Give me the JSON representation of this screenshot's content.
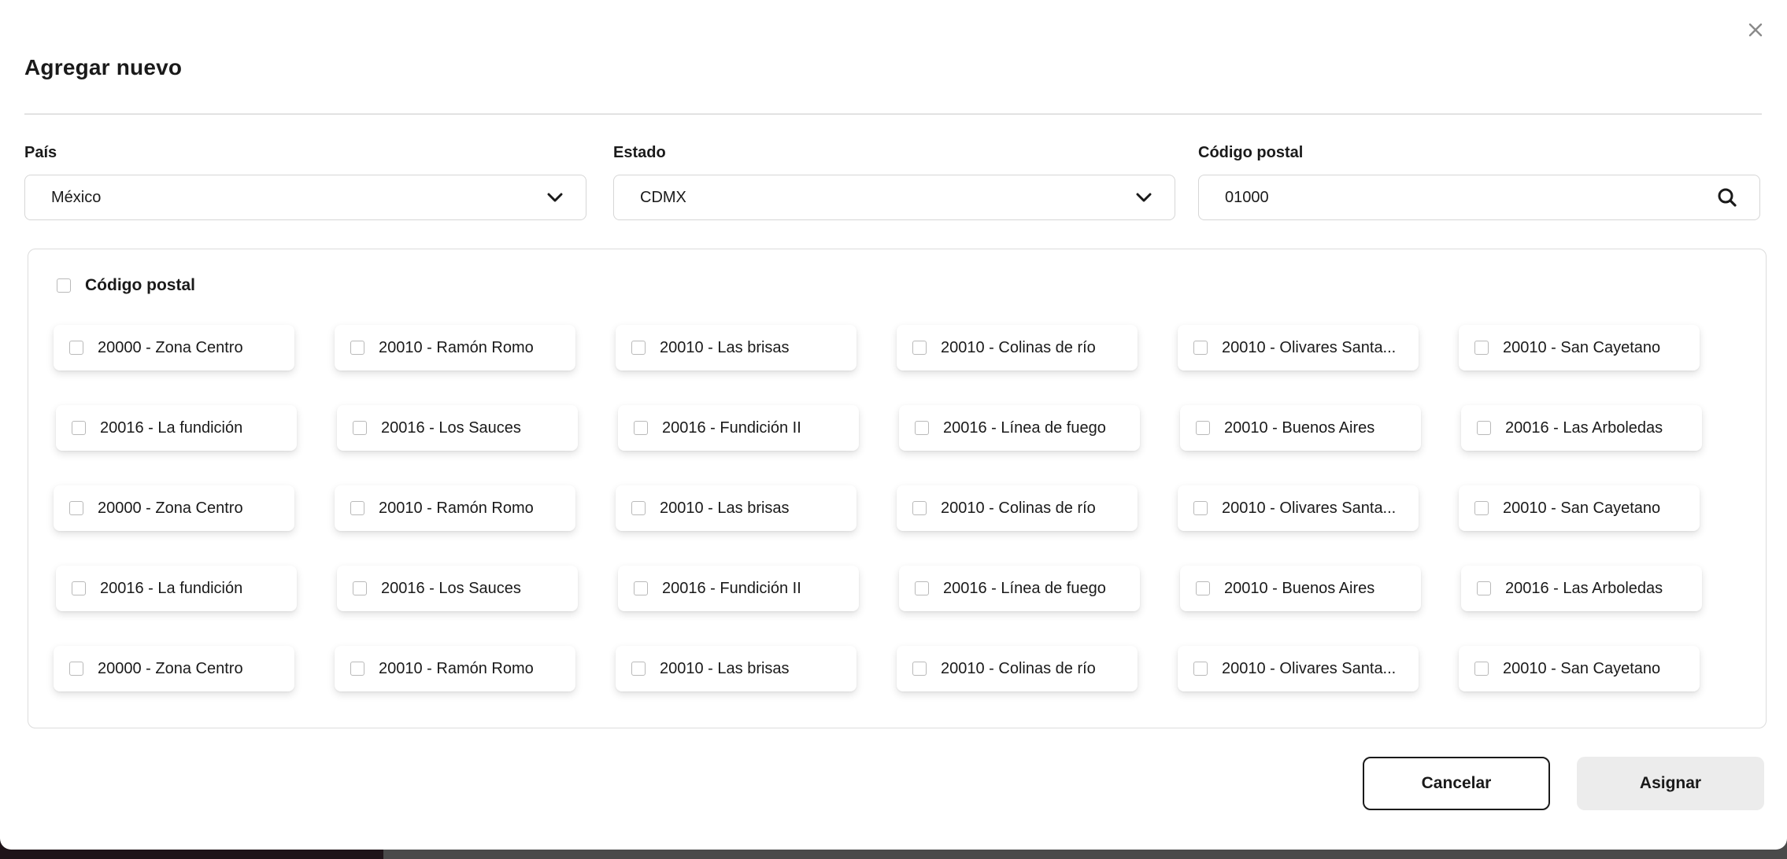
{
  "modal": {
    "title": "Agregar nuevo",
    "close_icon": "close-icon"
  },
  "filters": {
    "country": {
      "label": "País",
      "value": "México",
      "icon": "chevron-down-icon"
    },
    "state": {
      "label": "Estado",
      "value": "CDMX",
      "icon": "chevron-down-icon"
    },
    "postal_code": {
      "label": "Código postal",
      "value": "01000",
      "icon": "search-icon"
    }
  },
  "results": {
    "select_all_label": "Código postal",
    "rows": [
      [
        "20000 - Zona Centro",
        "20010 - Ramón Romo",
        "20010 - Las brisas",
        "20010 - Colinas de río",
        "20010 - Olivares Santa...",
        "20010 - San Cayetano"
      ],
      [
        "20016 - La fundición",
        "20016 - Los Sauces",
        "20016 - Fundición II",
        "20016 - Línea de fuego",
        "20010 - Buenos Aires",
        "20016 - Las Arboledas"
      ],
      [
        "20000 - Zona Centro",
        "20010 - Ramón Romo",
        "20010 - Las brisas",
        "20010 - Colinas de río",
        "20010 - Olivares Santa...",
        "20010 - San Cayetano"
      ],
      [
        "20016 - La fundición",
        "20016 - Los Sauces",
        "20016 - Fundición II",
        "20016 - Línea de fuego",
        "20010 - Buenos Aires",
        "20016 - Las Arboledas"
      ],
      [
        "20000 - Zona Centro",
        "20010 - Ramón Romo",
        "20010 - Las brisas",
        "20010 - Colinas de río",
        "20010 - Olivares Santa...",
        "20010 - San Cayetano"
      ]
    ]
  },
  "actions": {
    "cancel_label": "Cancelar",
    "assign_label": "Asignar"
  }
}
